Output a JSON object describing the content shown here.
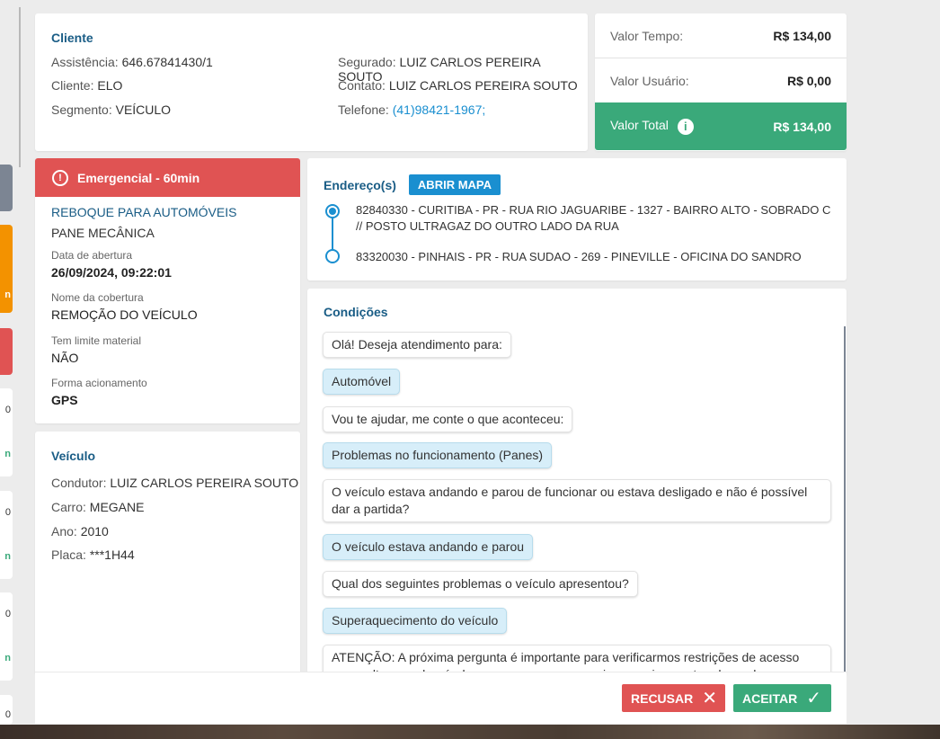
{
  "cliente": {
    "title": "Cliente",
    "assistencia_label": "Assistência:",
    "assistencia": "646.67841430/1",
    "cliente_label": "Cliente:",
    "cliente": "ELO",
    "segmento_label": "Segmento:",
    "segmento": "VEÍCULO",
    "segurado_label": "Segurado:",
    "segurado": "LUIZ CARLOS PEREIRA SOUTO",
    "contato_label": "Contato:",
    "contato": "LUIZ CARLOS PEREIRA SOUTO",
    "telefone_label": "Telefone:",
    "telefone": "(41)98421-1967;"
  },
  "valores": {
    "tempo_label": "Valor Tempo:",
    "tempo": "R$ 134,00",
    "usuario_label": "Valor Usuário:",
    "usuario": "R$ 0,00",
    "total_label": "Valor Total",
    "total": "R$ 134,00",
    "total_color": "#3aa97a"
  },
  "servico": {
    "badge": "Emergencial - 60min",
    "tipo": "REBOQUE PARA AUTOMÓVEIS",
    "motivo": "PANE MECÂNICA",
    "data_label": "Data de abertura",
    "data": "26/09/2024, 09:22:01",
    "cobertura_label": "Nome da cobertura",
    "cobertura": "REMOÇÃO DO VEÍCULO",
    "limite_label": "Tem limite material",
    "limite": "NÃO",
    "forma_label": "Forma acionamento",
    "forma": "GPS",
    "badge_color": "#e05353"
  },
  "veiculo": {
    "title": "Veículo",
    "condutor_label": "Condutor:",
    "condutor": "LUIZ CARLOS PEREIRA SOUTO",
    "carro_label": "Carro:",
    "carro": "MEGANE",
    "ano_label": "Ano:",
    "ano": "2010",
    "placa_label": "Placa:",
    "placa": "***1H44"
  },
  "enderecos": {
    "title": "Endereço(s)",
    "map_button": "ABRIR MAPA",
    "origem": "82840330 - CURITIBA - PR - RUA RIO JAGUARIBE - 1327 - BAIRRO ALTO - SOBRADO C // POSTO ULTRAGAZ DO OUTRO LADO DA RUA",
    "destino": "83320030 - PINHAIS - PR - RUA SUDAO - 269 - PINEVILLE - OFICINA DO SANDRO"
  },
  "condicoes": {
    "title": "Condições",
    "messages": [
      {
        "text": "Olá! Deseja atendimento para:"
      },
      {
        "text": "Automóvel"
      },
      {
        "text": "Vou te ajudar, me conte o que aconteceu:"
      },
      {
        "text": "Problemas no funcionamento (Panes)"
      },
      {
        "text": "O veículo estava andando e parou de funcionar ou estava desligado e não é possível dar a partida?"
      },
      {
        "text": "O veículo estava andando e parou"
      },
      {
        "text": "Qual dos seguintes problemas o veículo apresentou?"
      },
      {
        "text": "Superaquecimento do veículo"
      },
      {
        "text": "ATENÇÃO: A próxima pergunta é importante para verificarmos restrições de acesso como altura ou desnível para que possamos enviar o equipamento adequado para"
      }
    ]
  },
  "actions": {
    "recusar": "RECUSAR",
    "aceitar": "ACEITAR",
    "recusar_color": "#e05353",
    "aceitar_color": "#3aa97a"
  },
  "side_cards": [
    "n",
    "0",
    "n",
    "0",
    "n",
    "0",
    "n",
    "0"
  ]
}
